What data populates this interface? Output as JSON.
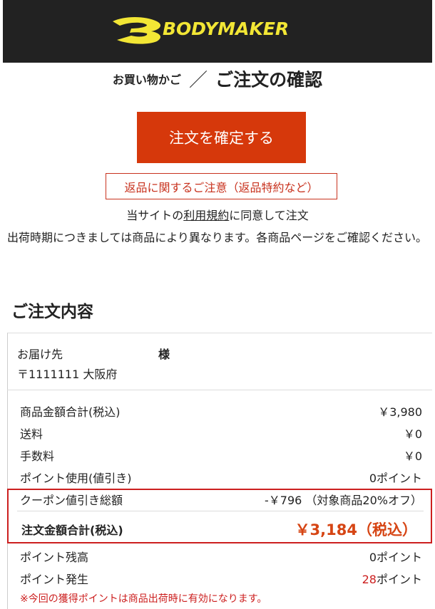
{
  "header": {
    "brand": "BODYMAKER",
    "brand_color": "#f2e635",
    "background": "#222222"
  },
  "breadcrumb": {
    "cart": "お買い物かご",
    "separator": "／",
    "current": "ご注文の確認"
  },
  "actions": {
    "confirm_label": "注文を確定する",
    "confirm_color": "#d6380b",
    "return_notice": "返品に関するご注意（返品特約など）"
  },
  "agreement": {
    "prefix": "当サイトの",
    "terms_link": "利用規約",
    "suffix": "に同意して注文"
  },
  "shipping_note": "出荷時期につきましては商品により異なります。各商品ページをご確認ください。",
  "order": {
    "section_title": "ご注文内容",
    "delivery_label": "お届け先",
    "delivery_honorific": "様",
    "delivery_address": "〒1111111 大阪府",
    "rows": [
      {
        "label": "商品金額合計(税込)",
        "value": "￥3,980"
      },
      {
        "label": "送料",
        "value": "￥0"
      },
      {
        "label": "手数料",
        "value": "￥0"
      },
      {
        "label": "ポイント使用(値引き)",
        "value": "0ポイント"
      }
    ],
    "coupon": {
      "label": "クーポン値引き総額",
      "value": "-￥796 （対象商品20%オフ）"
    },
    "total": {
      "label": "注文金額合計(税込)",
      "value": "￥3,184（税込）"
    },
    "points_balance": {
      "label": "ポイント残高",
      "value": "0ポイント"
    },
    "points_earned": {
      "label": "ポイント発生",
      "value_number": "28",
      "value_unit": "ポイント"
    },
    "note": "※今回の獲得ポイントは商品出荷時に有効になります。"
  }
}
